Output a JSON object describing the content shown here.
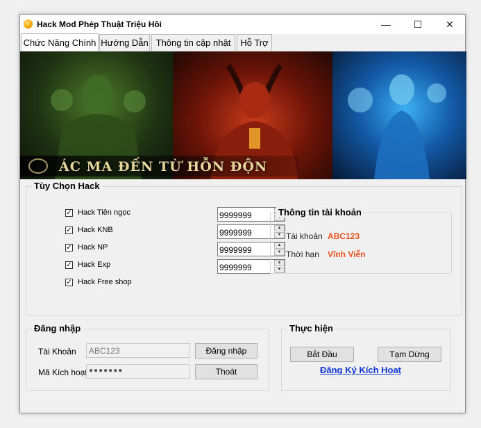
{
  "window": {
    "title": "Hack Mod Phép Thuật Triệu Hồi",
    "minimize_glyph": "—",
    "maximize_glyph": "☐",
    "close_glyph": "✕"
  },
  "tabs": [
    {
      "label": "Chức Năng Chính",
      "active": true
    },
    {
      "label": "Hướng Dẫn",
      "active": false
    },
    {
      "label": "Thông tin cập nhật",
      "active": false
    },
    {
      "label": "Hỗ Trợ",
      "active": false
    }
  ],
  "banner": {
    "caption": "ÁC MA ĐẾN TỪ HỖN ĐỘN"
  },
  "hack_options": {
    "legend": "Tùy Chọn Hack",
    "items": [
      {
        "label": "Hack Tiên ngọc",
        "checked": true,
        "value": "9999999"
      },
      {
        "label": "Hack KNB",
        "checked": true,
        "value": "9999999"
      },
      {
        "label": "Hack NP",
        "checked": true,
        "value": "9999999"
      },
      {
        "label": "Hack Exp",
        "checked": true,
        "value": "9999999"
      },
      {
        "label": "Hack Free shop",
        "checked": true
      }
    ],
    "check_glyph": "✓",
    "spin_up_glyph": "▲",
    "spin_down_glyph": "▼"
  },
  "account_info": {
    "legend": "Thông tin tài khoản",
    "account_label": "Tài khoản",
    "account_value": "ABC123",
    "expiry_label": "Thời hạn",
    "expiry_value": "Vĩnh Viễn",
    "value_color": "#e8501c"
  },
  "login": {
    "legend": "Đăng nhập",
    "account_label": "Tài Khoản",
    "account_value": "ABC123",
    "activation_label": "Mã Kích hoạt",
    "activation_value": "●●●●●●●",
    "login_button": "Đăng nhập",
    "exit_button": "Thoát"
  },
  "actions": {
    "legend": "Thực hiện",
    "start_button": "Bắt Đầu",
    "pause_button": "Tạm Dừng",
    "register_link": "Đăng Ký Kích Hoạt",
    "link_color": "#0b33d6"
  }
}
